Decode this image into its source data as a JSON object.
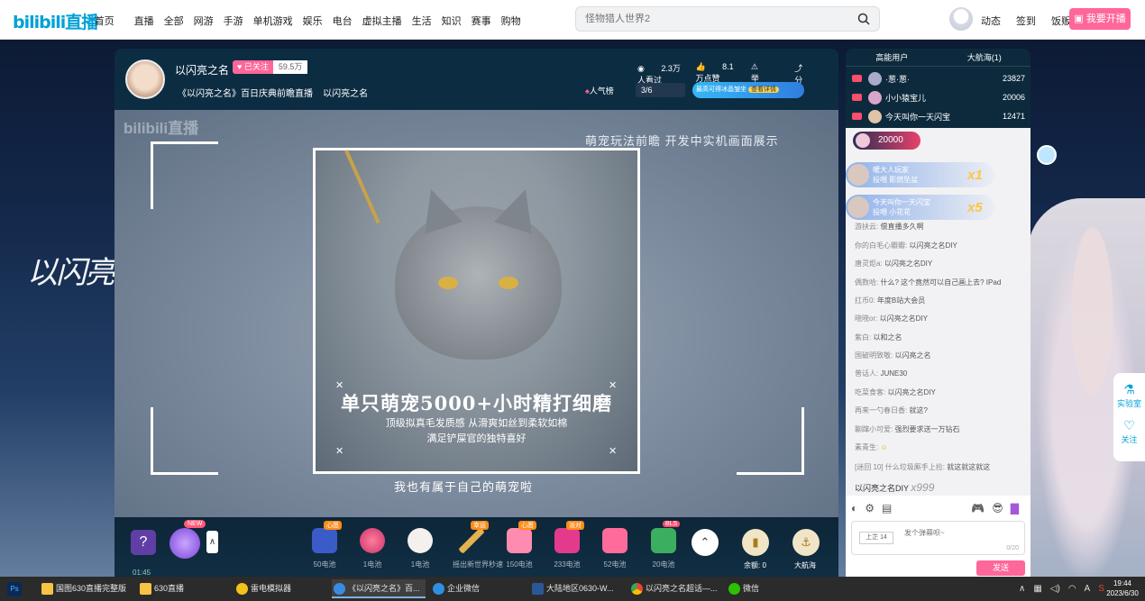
{
  "nav": {
    "logo": "bilibili直播",
    "links": [
      "首页",
      "直播",
      "全部",
      "网游",
      "手游",
      "单机游戏",
      "娱乐",
      "电台",
      "虚拟主播",
      "生活",
      "知识",
      "赛事",
      "购物"
    ],
    "search_placeholder": "怪物猎人世界2",
    "right_links": [
      "动态",
      "签到",
      "饭贩"
    ],
    "start_live": "我要开播"
  },
  "side": {
    "game_logo": "以闪亮之名",
    "float_lab": "实验室",
    "float_follow": "关注"
  },
  "room": {
    "anchor_name": "以闪亮之名",
    "follow_label": "已关注",
    "follower_count": "59.5万",
    "title": "《以闪亮之名》百日庆典前瞻直播",
    "title_tag": "以闪亮之名",
    "watched": "2.3万人看过",
    "likes": "8.1万点赞",
    "report": "举报",
    "share": "分享",
    "popularity": "人气榜",
    "rank_progress": "3/6",
    "banner_text": "最高可得冰晶皱坐",
    "banner_btn": "查看详情"
  },
  "video": {
    "watermark": "bilibili直播",
    "caption": "萌宠玩法前瞻 开发中实机画面展示",
    "headline": "单只萌宠5000+小时精打细磨",
    "sub1": "顶级拟真毛发质感 从滑爽如丝到柔软如棉",
    "sub2": "满足铲屎官的独特喜好",
    "bottom_caption": "我也有属于自己的萌宠啦"
  },
  "gifts": {
    "time": "01:45",
    "new_tag": "NEW",
    "items": [
      {
        "price": "50电池",
        "tag": "心愿"
      },
      {
        "price": "1电池",
        "tag": ""
      },
      {
        "price": "1电池",
        "tag": ""
      },
      {
        "price": "摇出新世界秒速",
        "tag": "幸运"
      },
      {
        "price": "150电池",
        "tag": "心愿"
      },
      {
        "price": "233电池",
        "tag": "派对"
      },
      {
        "price": "52电池",
        "tag": ""
      },
      {
        "price": "20电池",
        "tag": "BLS"
      }
    ],
    "balance": "余额: 0",
    "fleet": "大航海"
  },
  "ranks": {
    "tab_high": "高能用户",
    "tab_fleet": "大航海(1)",
    "rows": [
      {
        "name": "·葱·葱·",
        "score": "23827"
      },
      {
        "name": "小小猿宝儿",
        "score": "20006"
      },
      {
        "name": "今天叫你一天闪宝",
        "score": "12471"
      }
    ]
  },
  "chat": {
    "gold": "20000",
    "pops": [
      {
        "user": "暖大人玩家",
        "action": "投喂 影燃坠盆",
        "count": "x1"
      },
      {
        "user": "今天叫你一天闪宝",
        "action": "投喂 小花花",
        "count": "x5"
      }
    ],
    "lines": [
      {
        "user": "游扶云:",
        "msg": "偿直播多久啊"
      },
      {
        "user": "你的白毛心瓣瓣:",
        "msg": "以闪亮之名DIY"
      },
      {
        "user": "唐灵炬a:",
        "msg": "以闪亮之名DIY"
      },
      {
        "user": "偶数哈:",
        "msg": "什么? 这个竟然可以自己画上去? IPad"
      },
      {
        "user": "扛币0:",
        "msg": "年度B站大会员"
      },
      {
        "user": "晓晓or:",
        "msg": "以闪亮之名DIY"
      },
      {
        "user": "紫白:",
        "msg": "以和之名"
      },
      {
        "user": "国破明致敬:",
        "msg": "以闪亮之名"
      },
      {
        "user": "普话人:",
        "msg": "JUNE30"
      },
      {
        "user": "吃菜食客:",
        "msg": "以闪亮之名DIY"
      },
      {
        "user": "再来一勺春日香:",
        "msg": "就这?"
      },
      {
        "user": "聊蹿小可爱:",
        "msg": "强烈要求送一万钻石"
      },
      {
        "user": "素青生:",
        "msg": ""
      },
      {
        "user": "[迷回 10] 什么垃圾厮手上捡:",
        "msg": "就这就这就这"
      }
    ],
    "footer_user": "以闪亮之名DIY",
    "footer_count": "x999",
    "medal": "上芷 14",
    "placeholder": "发个弹幕呗~",
    "char_count": "0/20",
    "send": "发送"
  },
  "taskbar": {
    "items": [
      "国图630直播完整版",
      "630直播",
      "雷电模拟器",
      "《以闪亮之名》百...",
      "企业微信",
      "大陆地区0630-W...",
      "以闪亮之名超话—...",
      "微信"
    ],
    "time": "19:44",
    "date": "2023/6/30"
  }
}
